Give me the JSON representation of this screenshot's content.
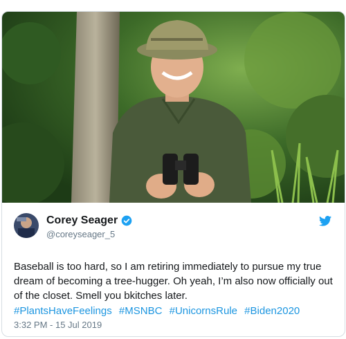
{
  "tweet": {
    "display_name": "Corey Seager",
    "handle": "@coreyseager_5",
    "text": "Baseball is too hard, so I am retiring immediately to pursue my true dream of becoming a tree-hugger. Oh yeah, I’m also now officially out of the closet. Smell you bkitches later.",
    "hashtags": [
      "#PlantsHaveFeelings",
      "#MSNBC",
      "#UnicornsRule",
      "#Biden2020"
    ],
    "timestamp": "3:32 PM - 15 Jul 2019"
  },
  "icons": {
    "verified": "verified-badge-icon",
    "platform": "twitter-bird-icon"
  },
  "colors": {
    "link": "#1b95e0",
    "text": "#14171a",
    "secondary": "#657786",
    "border": "#d6dde3"
  }
}
